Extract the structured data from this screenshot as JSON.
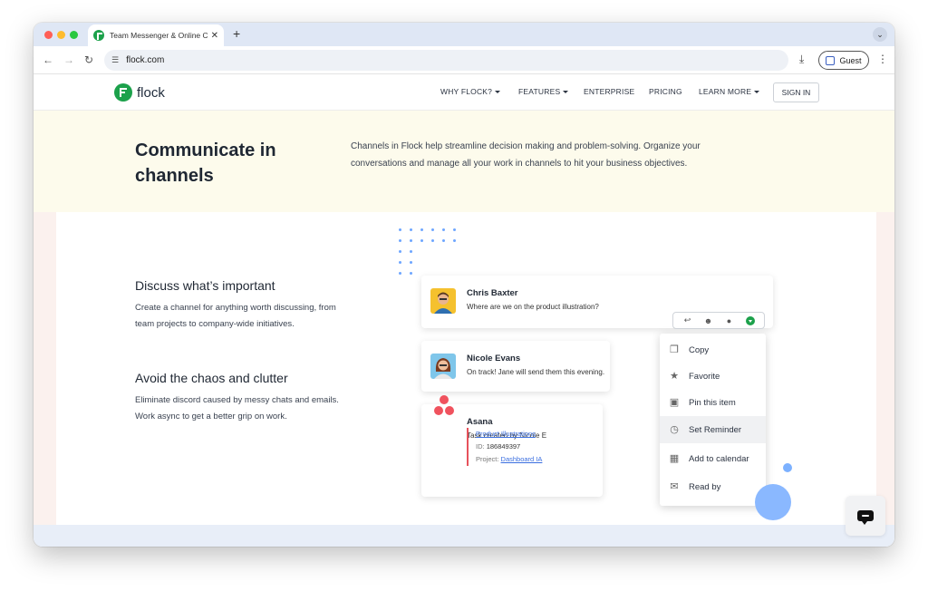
{
  "browser": {
    "tab_title": "Team Messenger & Online Co",
    "tab_close": "✕",
    "new_tab": "+",
    "url": "flock.com",
    "profile_label": "Guest",
    "tab_menu": "⌄"
  },
  "site": {
    "logo_text": "flock",
    "nav": {
      "why": "WHY FLOCK?",
      "features": "FEATURES",
      "enterprise": "ENTERPRISE",
      "pricing": "PRICING",
      "learn_more": "LEARN MORE",
      "sign_in": "SIGN IN"
    }
  },
  "hero": {
    "title": "Communicate in channels",
    "description": "Channels in Flock help streamline decision making and problem-solving. Organize your conversations and manage all your work in channels to hit your business objectives."
  },
  "features": [
    {
      "title": "Discuss what’s important",
      "description": "Create a channel for anything worth discussing, from team projects to company-wide initiatives."
    },
    {
      "title": "Avoid the chaos and clutter",
      "description": "Eliminate discord caused by messy chats and emails. Work async to get a better grip on work."
    }
  ],
  "messages": {
    "chris": {
      "name": "Chris Baxter",
      "text": "Where are we on the product illustration?"
    },
    "nicole": {
      "name": "Nicole Evans",
      "text": "On track! Jane will send them this evening."
    },
    "asana": {
      "name": "Asana",
      "text": "Task created by Nicole E",
      "task_link": "Product Illustrations",
      "id_label": "ID:",
      "id_value": "186849397",
      "project_label": "Project:",
      "project_link": "Dashboard IA"
    }
  },
  "context_menu": {
    "items": [
      {
        "label": "Copy",
        "icon": "copy-icon"
      },
      {
        "label": "Favorite",
        "icon": "star-icon"
      },
      {
        "label": "Pin this item",
        "icon": "pin-icon"
      },
      {
        "label": "Set Reminder",
        "icon": "clock-icon"
      },
      {
        "label": "Add to calendar",
        "icon": "calendar-icon"
      },
      {
        "label": "Read by",
        "icon": "envelope-open-icon"
      }
    ]
  },
  "colors": {
    "brand_green": "#1ca14b",
    "hero_bg": "#fdfbec",
    "accent_blue": "#8ab8ff",
    "asana_red": "#f0525e"
  }
}
